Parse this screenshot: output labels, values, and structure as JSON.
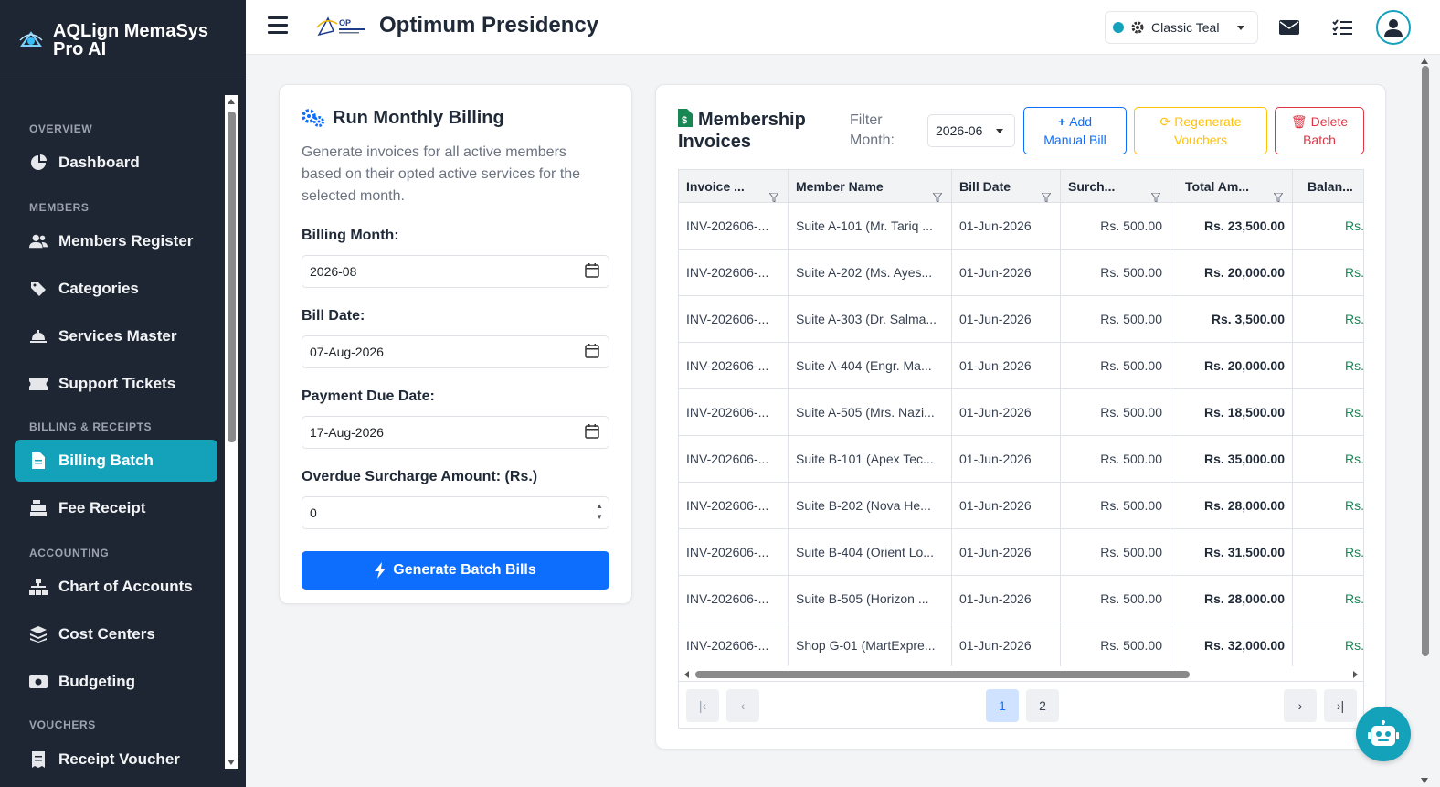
{
  "brand": {
    "name": "AQLign MemaSys Pro AI"
  },
  "header": {
    "title": "Optimum Presidency",
    "theme": "Classic Teal",
    "logo_text": "OP"
  },
  "sidebar": {
    "sections": [
      {
        "title": "OVERVIEW",
        "items": [
          {
            "label": "Dashboard",
            "icon": "pie-chart-icon"
          }
        ]
      },
      {
        "title": "MEMBERS",
        "items": [
          {
            "label": "Members Register",
            "icon": "users-icon"
          },
          {
            "label": "Categories",
            "icon": "tags-icon"
          },
          {
            "label": "Services Master",
            "icon": "service-bell-icon"
          },
          {
            "label": "Support Tickets",
            "icon": "ticket-icon"
          }
        ]
      },
      {
        "title": "BILLING & RECEIPTS",
        "items": [
          {
            "label": "Billing Batch",
            "icon": "invoice-icon",
            "active": true
          },
          {
            "label": "Fee Receipt",
            "icon": "cash-register-icon"
          }
        ]
      },
      {
        "title": "ACCOUNTING",
        "items": [
          {
            "label": "Chart of Accounts",
            "icon": "sitemap-icon"
          },
          {
            "label": "Cost Centers",
            "icon": "layers-icon"
          },
          {
            "label": "Budgeting",
            "icon": "money-bill-icon"
          }
        ]
      },
      {
        "title": "VOUCHERS",
        "items": [
          {
            "label": "Receipt Voucher",
            "icon": "receipt-icon"
          }
        ]
      }
    ]
  },
  "billing": {
    "title": "Run Monthly Billing",
    "description": "Generate invoices for all active members based on their opted active services for the selected month.",
    "billing_month_label": "Billing Month:",
    "billing_month": "2026-08",
    "bill_date_label": "Bill Date:",
    "bill_date": "07-Aug-2026",
    "due_date_label": "Payment Due Date:",
    "due_date": "17-Aug-2026",
    "surcharge_label": "Overdue Surcharge Amount: (Rs.)",
    "surcharge": "0",
    "generate_label": "Generate Batch Bills"
  },
  "invoices": {
    "title": "Membership Invoices",
    "filter_label": "Filter Month:",
    "filter_value": "2026-06",
    "add_label": "Add Manual Bill",
    "regen_label": "Regenerate Vouchers",
    "delete_label": "Delete Batch",
    "columns": [
      "Invoice ...",
      "Member Name",
      "Bill Date",
      "Surch...",
      "Total Am...",
      "Balan..."
    ],
    "rows": [
      [
        "INV-202606-...",
        "Suite A-101 (Mr. Tariq ...",
        "01-Jun-2026",
        "Rs. 500.00",
        "Rs. 23,500.00",
        "Rs."
      ],
      [
        "INV-202606-...",
        "Suite A-202 (Ms. Ayes...",
        "01-Jun-2026",
        "Rs. 500.00",
        "Rs. 20,000.00",
        "Rs."
      ],
      [
        "INV-202606-...",
        "Suite A-303 (Dr. Salma...",
        "01-Jun-2026",
        "Rs. 500.00",
        "Rs. 3,500.00",
        "Rs."
      ],
      [
        "INV-202606-...",
        "Suite A-404 (Engr. Ma...",
        "01-Jun-2026",
        "Rs. 500.00",
        "Rs. 20,000.00",
        "Rs."
      ],
      [
        "INV-202606-...",
        "Suite A-505 (Mrs. Nazi...",
        "01-Jun-2026",
        "Rs. 500.00",
        "Rs. 18,500.00",
        "Rs."
      ],
      [
        "INV-202606-...",
        "Suite B-101 (Apex Tec...",
        "01-Jun-2026",
        "Rs. 500.00",
        "Rs. 35,000.00",
        "Rs."
      ],
      [
        "INV-202606-...",
        "Suite B-202 (Nova He...",
        "01-Jun-2026",
        "Rs. 500.00",
        "Rs. 28,000.00",
        "Rs."
      ],
      [
        "INV-202606-...",
        "Suite B-404 (Orient Lo...",
        "01-Jun-2026",
        "Rs. 500.00",
        "Rs. 31,500.00",
        "Rs."
      ],
      [
        "INV-202606-...",
        "Suite B-505 (Horizon ...",
        "01-Jun-2026",
        "Rs. 500.00",
        "Rs. 28,000.00",
        "Rs."
      ],
      [
        "INV-202606-...",
        "Shop G-01 (MartExpre...",
        "01-Jun-2026",
        "Rs. 500.00",
        "Rs. 32,000.00",
        "Rs."
      ]
    ],
    "pages": [
      "1",
      "2"
    ],
    "current_page": "1"
  },
  "colors": {
    "accent": "#14a2ba",
    "primary": "#0d6efd",
    "warning": "#ffc107",
    "danger": "#dc3545",
    "sidebar": "#1e2533"
  }
}
